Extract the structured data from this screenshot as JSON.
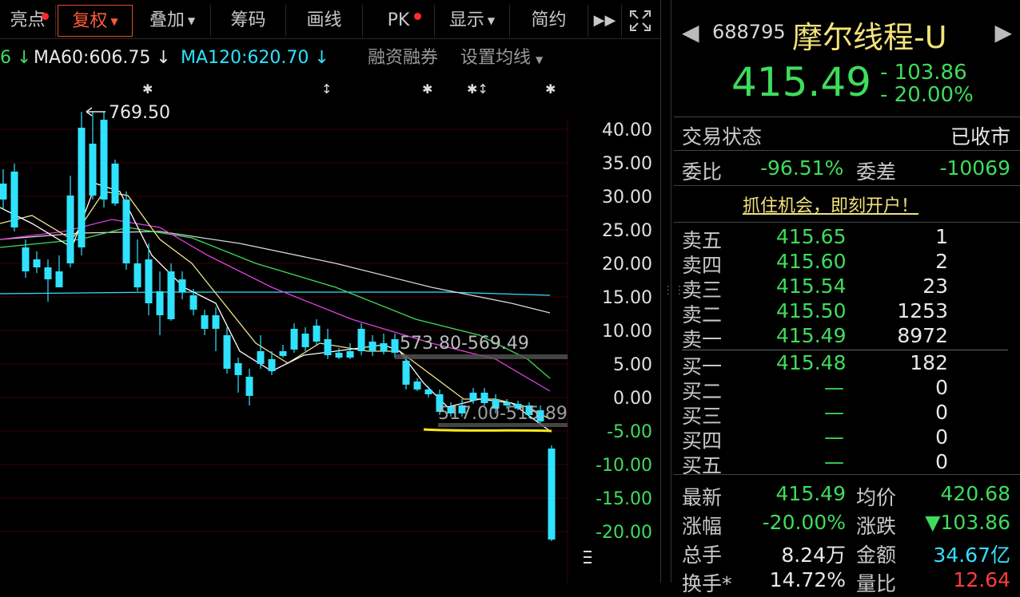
{
  "toolbar": {
    "items": [
      {
        "label": "亮点",
        "dot": true
      },
      {
        "label": "复权",
        "dropdown": true,
        "active": true
      },
      {
        "label": "叠加",
        "dropdown": true
      },
      {
        "label": "筹码"
      },
      {
        "label": "画线"
      },
      {
        "label": "PK",
        "dot": true
      },
      {
        "label": "显示",
        "dropdown": true
      },
      {
        "label": "简约"
      }
    ],
    "more_icon": "fast-forward-icon",
    "expand_icon": "fullscreen-icon"
  },
  "ma": {
    "prefix": "6 ↓",
    "ma60": "MA60:606.75 ↓",
    "ma120": "MA120:620.70 ↓",
    "margin_label": "融资融券",
    "settings_label": "设置均线",
    "colors": {
      "prefix": "#3fdc5c",
      "ma60": "#e8e8e8",
      "ma120": "#2fe2ff"
    }
  },
  "chart": {
    "high_label": "769.50",
    "box1_label": "573.80-569.49",
    "box2_label": "517.00-515.89",
    "y_ticks": [
      "40.00",
      "35.00",
      "30.00",
      "25.00",
      "20.00",
      "15.00",
      "10.00",
      "5.00",
      "0.00",
      "-5.00",
      "-10.00",
      "-15.00",
      "-20.00"
    ],
    "colors": {
      "up": "#ff3c3c",
      "down": "#2fe2ff",
      "grid": "#3a0000",
      "axis_pos": "#e0e0e0",
      "axis_neg": "#3fdc5c",
      "highlight": "#f8e81c"
    }
  },
  "panel": {
    "code": "688795",
    "name": "摩尔线程-U",
    "price": "415.49",
    "change": "- 103.86",
    "change_pct": "- 20.00%",
    "status_label": "交易状态",
    "status_value": "已收市",
    "wb_label": "委比",
    "wb_value": "-96.51%",
    "wc_label": "委差",
    "wc_value": "-10069",
    "banner": "抓住机会，即刻开户！",
    "asks": [
      {
        "label": "卖五",
        "price": "415.65",
        "vol": "1"
      },
      {
        "label": "卖四",
        "price": "415.60",
        "vol": "2"
      },
      {
        "label": "卖三",
        "price": "415.54",
        "vol": "23"
      },
      {
        "label": "卖二",
        "price": "415.50",
        "vol": "1253"
      },
      {
        "label": "卖一",
        "price": "415.49",
        "vol": "8972"
      }
    ],
    "bids": [
      {
        "label": "买一",
        "price": "415.48",
        "vol": "182"
      },
      {
        "label": "买二",
        "price": "—",
        "vol": "0"
      },
      {
        "label": "买三",
        "price": "—",
        "vol": "0"
      },
      {
        "label": "买四",
        "price": "—",
        "vol": "0"
      },
      {
        "label": "买五",
        "price": "—",
        "vol": "0"
      }
    ],
    "stats": [
      {
        "l1": "最新",
        "v1": "415.49",
        "l2": "均价",
        "v2": "420.68",
        "c1": "grn",
        "c2": "grn"
      },
      {
        "l1": "涨幅",
        "v1": "-20.00%",
        "l2": "涨跌",
        "v2": "▼103.86",
        "c1": "grn",
        "c2": "grn"
      },
      {
        "l1": "总手",
        "v1": "8.24万",
        "l2": "金额",
        "v2": "34.67亿",
        "c1": "wht",
        "c2": "cyan"
      },
      {
        "l1": "换手*",
        "v1": "14.72%",
        "l2": "量比",
        "v2": "12.64",
        "c1": "wht",
        "c2": "red"
      }
    ]
  }
}
